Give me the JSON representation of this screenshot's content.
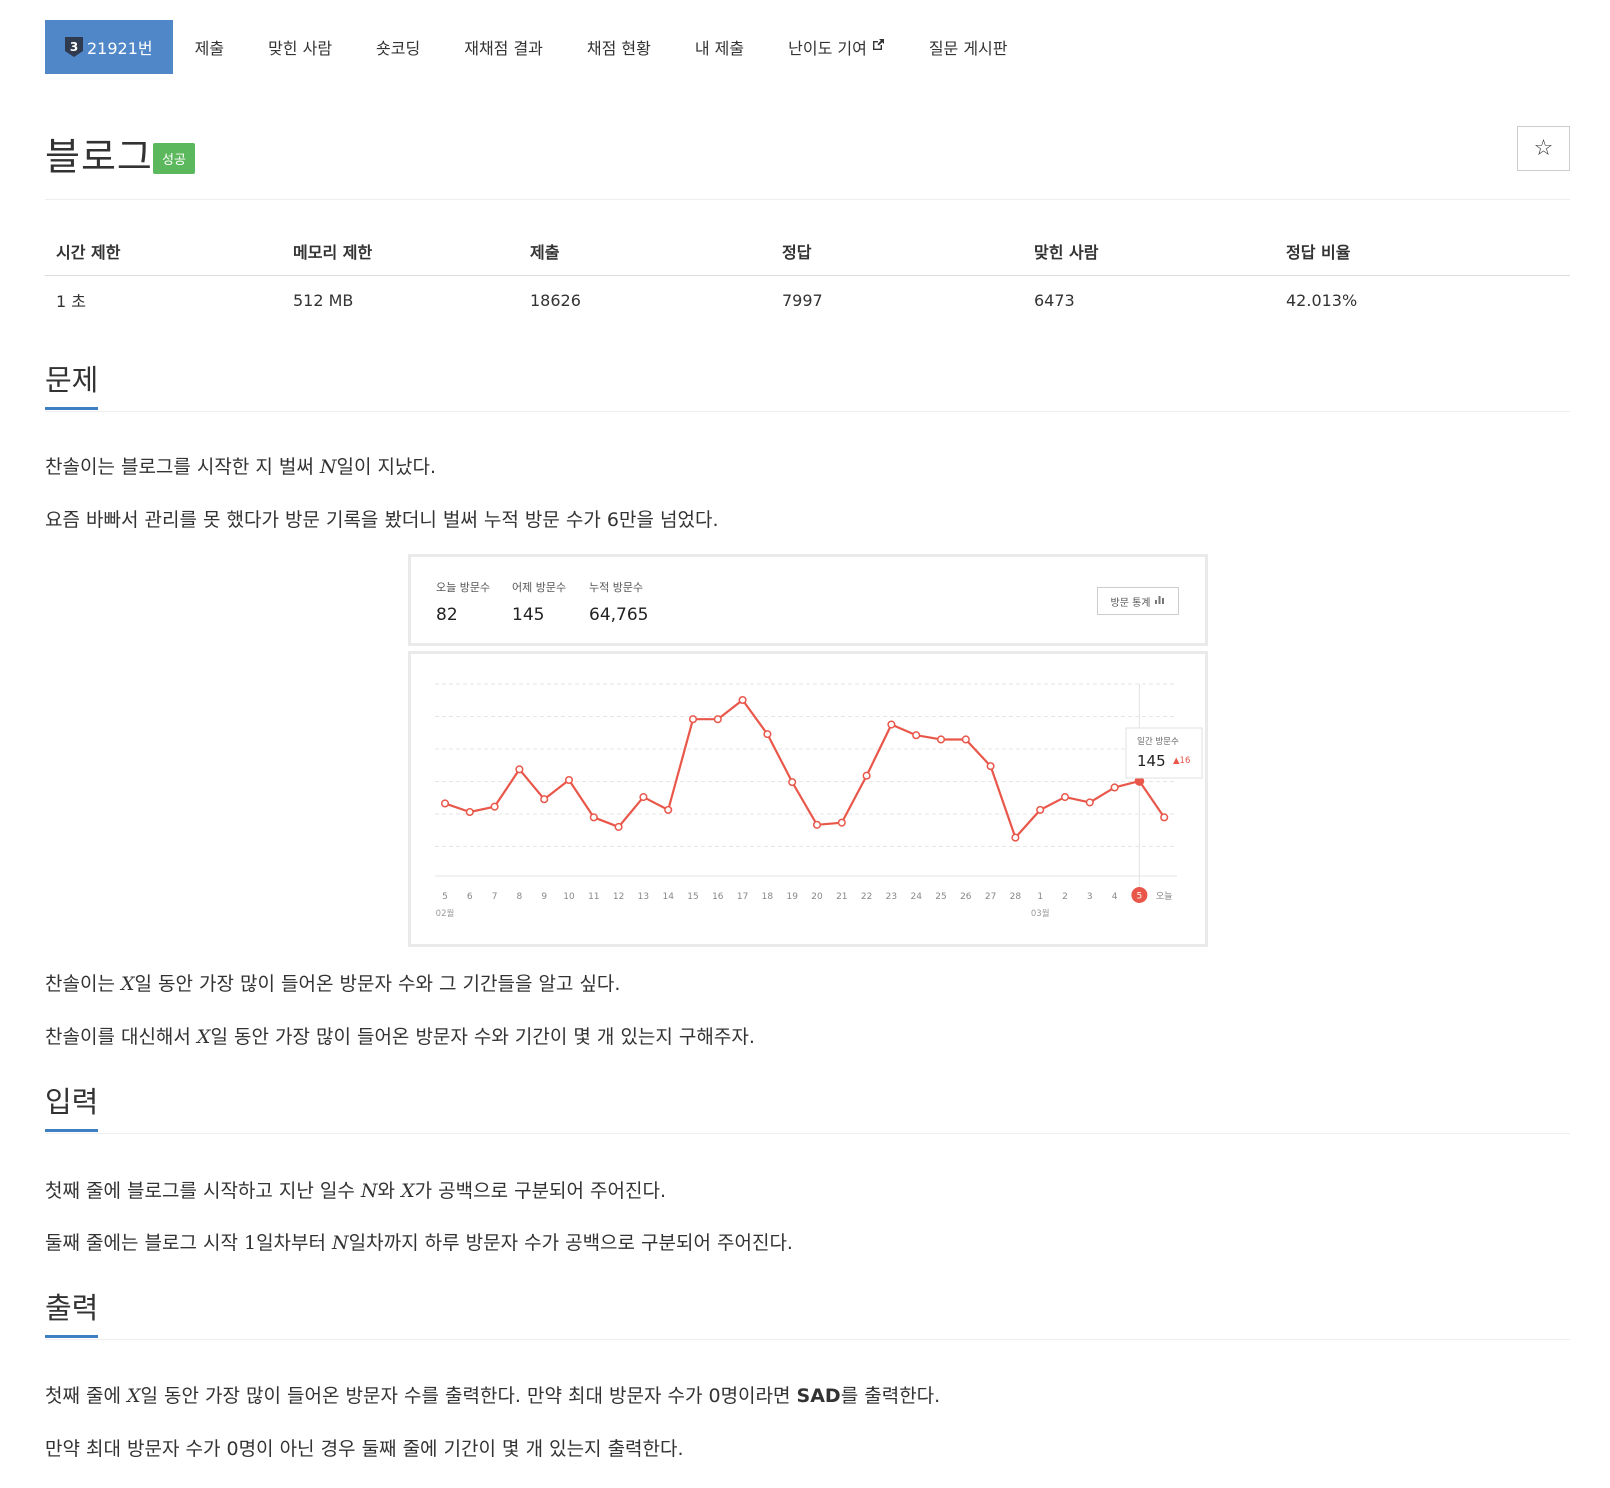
{
  "nav": {
    "problem_tier": "3",
    "problem_number": "21921번",
    "items": [
      "제출",
      "맞힌 사람",
      "숏코딩",
      "재채점 결과",
      "채점 현황",
      "내 제출",
      "난이도 기여",
      "질문 게시판"
    ]
  },
  "title": {
    "text": "블로그",
    "status": "성공",
    "star_label": "☆"
  },
  "info": {
    "headers": [
      "시간 제한",
      "메모리 제한",
      "제출",
      "정답",
      "맞힌 사람",
      "정답 비율"
    ],
    "values": [
      "1 초",
      "512 MB",
      "18626",
      "7997",
      "6473",
      "42.013%"
    ]
  },
  "sections": {
    "problem": {
      "title": "문제",
      "p1_before": "찬솔이는 블로그를 시작한 지 벌써 ",
      "p1_var": "N",
      "p1_after": "일이 지났다.",
      "p2": "요즘 바빠서 관리를 못 했다가 방문 기록을 봤더니 벌써 누적 방문 수가 6만을 넘었다.",
      "p3_before": "찬솔이는 ",
      "p3_var": "X",
      "p3_after": "일 동안 가장 많이 들어온 방문자 수와 그 기간들을 알고 싶다.",
      "p4_before": "찬솔이를 대신해서 ",
      "p4_var": "X",
      "p4_after": "일 동안 가장 많이 들어온 방문자 수와 기간이 몇 개 있는지 구해주자."
    },
    "input": {
      "title": "입력",
      "p1_a": "첫째 줄에 블로그를 시작하고 지난 일수 ",
      "p1_n": "N",
      "p1_b": "와 ",
      "p1_x": "X",
      "p1_c": "가 공백으로 구분되어 주어진다.",
      "p2_a": "둘째 줄에는 블로그 시작 ",
      "p2_one": "1",
      "p2_b": "일차부터 ",
      "p2_n": "N",
      "p2_c": "일차까지 하루 방문자 수가 공백으로 구분되어 주어진다."
    },
    "output": {
      "title": "출력",
      "p1_a": "첫째 줄에 ",
      "p1_x": "X",
      "p1_b": "일 동안 가장 많이 들어온 방문자 수를 출력한다. 만약 최대 방문자 수가 0명이라면 ",
      "p1_sad": "SAD",
      "p1_c": "를 출력한다.",
      "p2": "만약 최대 방문자 수가 0명이 아닌 경우 둘째 줄에 기간이 몇 개 있는지 출력한다."
    }
  },
  "stats_image": {
    "today_label": "오늘 방문수",
    "today_value": "82",
    "yesterday_label": "어제 방문수",
    "yesterday_value": "145",
    "total_label": "누적 방문수",
    "total_value": "64,765",
    "button_label": "방문 통계",
    "tooltip_label": "일간 방문수",
    "tooltip_value": "145",
    "tooltip_delta": "▲16",
    "month_labels": [
      "02월",
      "03월"
    ]
  },
  "chart_data": {
    "type": "line",
    "x": [
      "5",
      "6",
      "7",
      "8",
      "9",
      "10",
      "11",
      "12",
      "13",
      "14",
      "15",
      "16",
      "17",
      "18",
      "19",
      "20",
      "21",
      "22",
      "23",
      "24",
      "25",
      "26",
      "27",
      "28",
      "1",
      "2",
      "3",
      "4",
      "5",
      "오늘"
    ],
    "values": [
      108,
      100,
      105,
      140,
      112,
      130,
      95,
      86,
      114,
      102,
      187,
      187,
      205,
      173,
      128,
      88,
      90,
      134,
      182,
      172,
      168,
      168,
      143,
      76,
      102,
      114,
      109,
      123,
      129,
      95
    ],
    "ylim": [
      40,
      220
    ],
    "highlight_index": 28,
    "color": "#e9574a"
  }
}
